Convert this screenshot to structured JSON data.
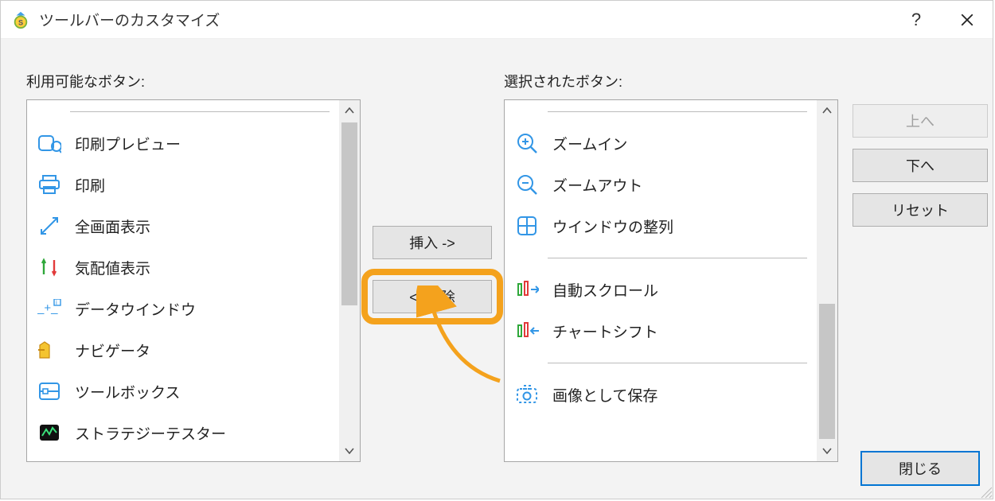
{
  "window": {
    "title": "ツールバーのカスタマイズ"
  },
  "labels": {
    "available": "利用可能なボタン:",
    "selected": "選択されたボタン:"
  },
  "buttons": {
    "insert": "挿入 ->",
    "remove": "<- 削除",
    "up": "上へ",
    "down": "下へ",
    "reset": "リセット",
    "close": "閉じる"
  },
  "available_items": [
    {
      "icon": "print-preview",
      "label": "印刷プレビュー"
    },
    {
      "icon": "print",
      "label": "印刷"
    },
    {
      "icon": "fullscreen",
      "label": "全画面表示"
    },
    {
      "icon": "marketwatch",
      "label": "気配値表示"
    },
    {
      "icon": "datawindow",
      "label": "データウインドウ"
    },
    {
      "icon": "navigator",
      "label": "ナビゲータ"
    },
    {
      "icon": "toolbox",
      "label": "ツールボックス"
    },
    {
      "icon": "strategytester",
      "label": "ストラテジーテスター"
    }
  ],
  "selected_items": [
    {
      "type": "sep"
    },
    {
      "icon": "zoomin",
      "label": "ズームイン"
    },
    {
      "icon": "zoomout",
      "label": "ズームアウト"
    },
    {
      "icon": "tilewindows",
      "label": "ウインドウの整列"
    },
    {
      "type": "sep"
    },
    {
      "icon": "autoscroll",
      "label": "自動スクロール"
    },
    {
      "icon": "chartshift",
      "label": "チャートシフト"
    },
    {
      "type": "sep"
    },
    {
      "icon": "saveimage",
      "label": "画像として保存"
    }
  ]
}
